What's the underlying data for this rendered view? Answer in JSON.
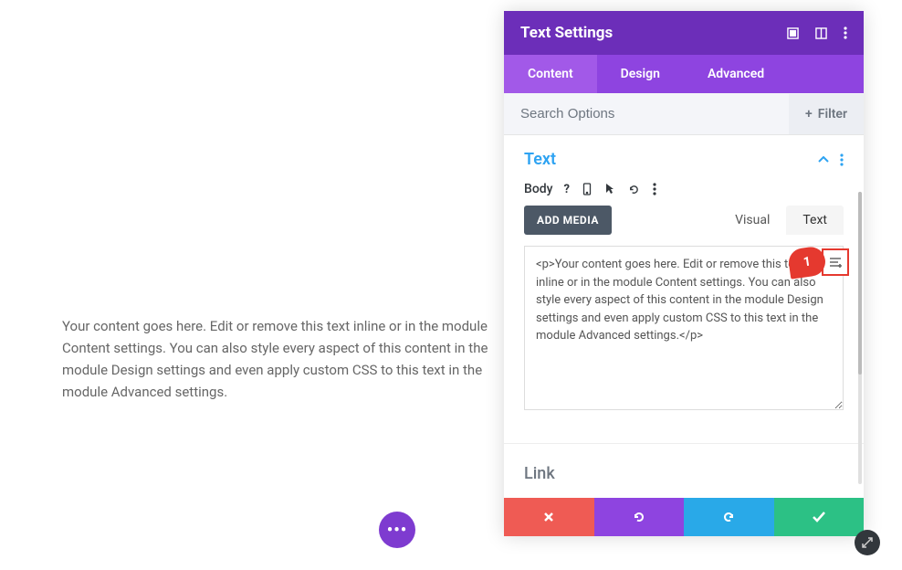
{
  "main_text": "Your content goes here. Edit or remove this text inline or in the module Content settings. You can also style every aspect of this content in the module Design settings and even apply custom CSS to this text in the module Advanced settings.",
  "panel": {
    "title": "Text Settings",
    "tabs": {
      "content": "Content",
      "design": "Design",
      "advanced": "Advanced"
    },
    "search": {
      "placeholder": "Search Options",
      "filter": "Filter"
    }
  },
  "text_section": {
    "title": "Text",
    "body_label": "Body",
    "add_media": "ADD MEDIA",
    "editor_tabs": {
      "visual": "Visual",
      "text": "Text"
    },
    "editor_content": "<p>Your content goes here. Edit or remove this text inline or in the module Content settings. You can also style every aspect of this content in the module Design settings and even apply custom CSS to this text in the module Advanced settings.</p>"
  },
  "link_section": {
    "title": "Link"
  },
  "annotation": {
    "number": "1"
  },
  "fab": "•••"
}
